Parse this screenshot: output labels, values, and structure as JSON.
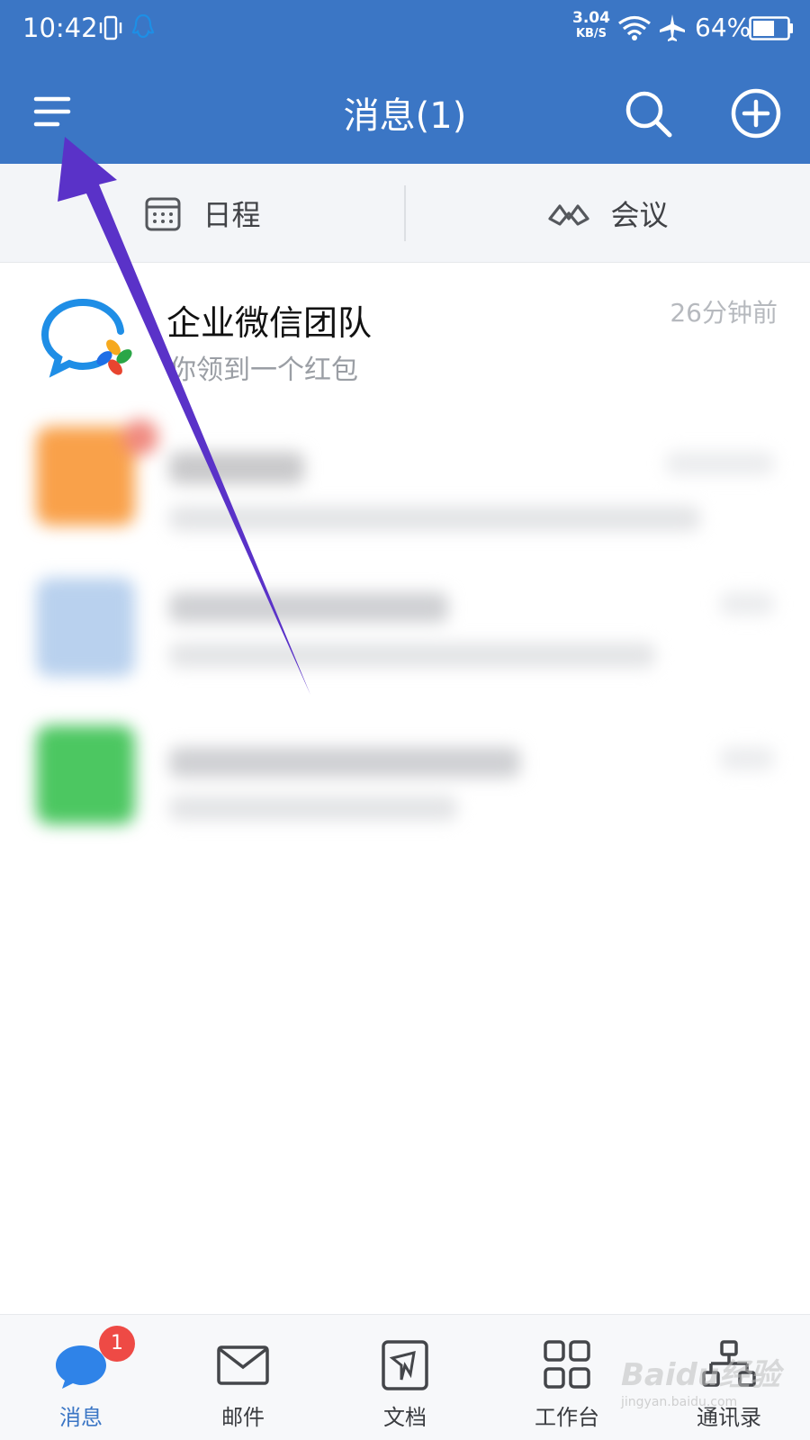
{
  "status_bar": {
    "time": "10:42",
    "net_speed_value": "3.04",
    "net_speed_unit": "KB/S",
    "battery_percent": "64%",
    "battery_level": 0.64
  },
  "header": {
    "title": "消息(1)",
    "bg_color": "#3b76c5"
  },
  "shortcuts": [
    {
      "label": "日程",
      "icon": "calendar-icon"
    },
    {
      "label": "会议",
      "icon": "meeting-icon"
    }
  ],
  "messages": [
    {
      "title": "企业微信团队",
      "subtitle": "你领到一个红包",
      "time": "26分钟前",
      "icon": "wecom-logo-icon"
    }
  ],
  "bottom_nav": [
    {
      "label": "消息",
      "icon": "chat-bubble-icon",
      "active": true,
      "badge": "1"
    },
    {
      "label": "邮件",
      "icon": "mail-icon",
      "active": false
    },
    {
      "label": "文档",
      "icon": "document-icon",
      "active": false
    },
    {
      "label": "工作台",
      "icon": "grid-icon",
      "active": false
    },
    {
      "label": "通讯录",
      "icon": "org-chart-icon",
      "active": false
    }
  ],
  "watermark": {
    "text": "Baidu经验",
    "sub": "jingyan.baidu.com"
  },
  "colors": {
    "accent": "#3b76c5",
    "badge": "#ee4a45",
    "arrow": "#5a32c8"
  }
}
